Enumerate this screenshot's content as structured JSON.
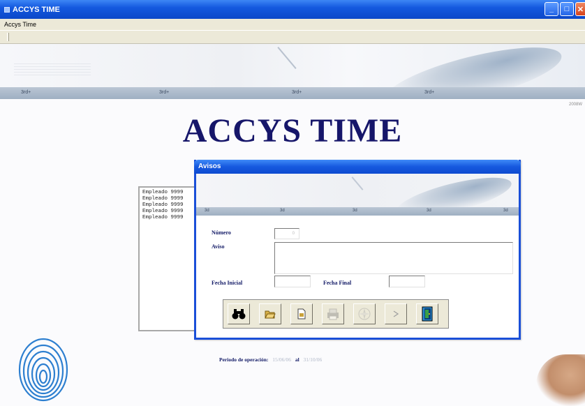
{
  "window": {
    "title": "ACCYS TIME",
    "menu_label": "Accys Time"
  },
  "banner": {
    "strip_marks": [
      "3rd+",
      "3rd+",
      "3rd+",
      "3rd+"
    ],
    "corner_text": "2008W"
  },
  "main_title": "ACCYS TIME",
  "log_lines": [
    "Empleado 9999",
    "Empleado 9999",
    "Empleado 9999",
    "Empleado 9999",
    "Empleado 9999"
  ],
  "dialog": {
    "title": "Avisos",
    "strip_marks": [
      "3d",
      "3d",
      "3d",
      "3d",
      "3d"
    ],
    "numero_label": "Número",
    "numero_value": "0",
    "aviso_label": "Aviso",
    "fecha_inicial_label": "Fecha Inicial",
    "fecha_final_label": "Fecha Final",
    "buttons": [
      {
        "icon": "binoculars-icon"
      },
      {
        "icon": "open-folder-icon"
      },
      {
        "icon": "document-icon"
      },
      {
        "icon": "print-icon"
      },
      {
        "icon": "compass-icon"
      },
      {
        "icon": "next-arrow-icon"
      },
      {
        "icon": "exit-door-icon"
      }
    ]
  },
  "footer": {
    "period_label": "Periodo de operación:",
    "period_from": "15/06/06",
    "period_sep": "al",
    "period_to": "31/10/06"
  },
  "colors": {
    "title_navy": "#16166a",
    "xp_blue": "#1459df",
    "label_navy": "#121a66"
  }
}
